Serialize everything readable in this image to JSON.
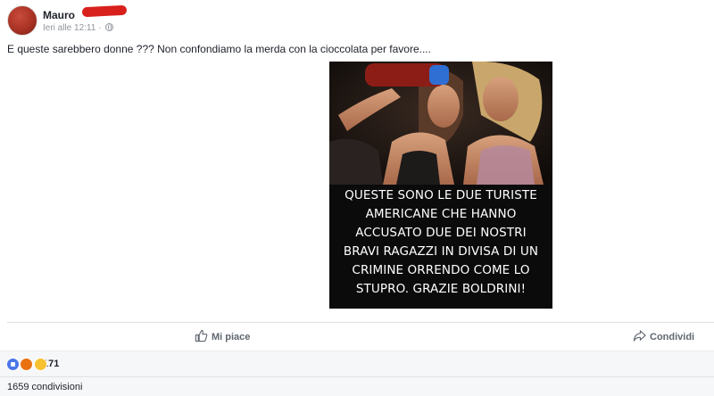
{
  "post": {
    "author_first_name": "Mauro",
    "timestamp": "Ieri alle 12:11",
    "separator": "·",
    "privacy_icon": "globe-icon",
    "text": "E queste sarebbero donne ??? Non confondiamo la merda con la cioccolata per favore...."
  },
  "meme": {
    "caption_lines": [
      "QUESTE SONO LE DUE TURISTE",
      "AMERICANE CHE HANNO",
      "ACCUSATO  DUE DEI NOSTRI",
      "BRAVI RAGAZZI IN DIVISA DI UN",
      "CRIMINE ORRENDO COME LO",
      "STUPRO. GRAZIE BOLDRINI!"
    ]
  },
  "actions": {
    "like_label": "Mi piace",
    "like_icon": "thumbs-up-icon",
    "share_label": "Condividi",
    "share_icon": "share-arrow-icon"
  },
  "reactions": {
    "icons": [
      "like-reaction-icon",
      "angry-reaction-icon",
      "haha-reaction-icon"
    ],
    "count": "171"
  },
  "shares": {
    "label": "1659 condivisioni"
  },
  "colors": {
    "text": "#1d2129",
    "muted": "#90949c",
    "action": "#606770",
    "redaction": "#d8201c",
    "like_reaction": "#4a76e8"
  }
}
